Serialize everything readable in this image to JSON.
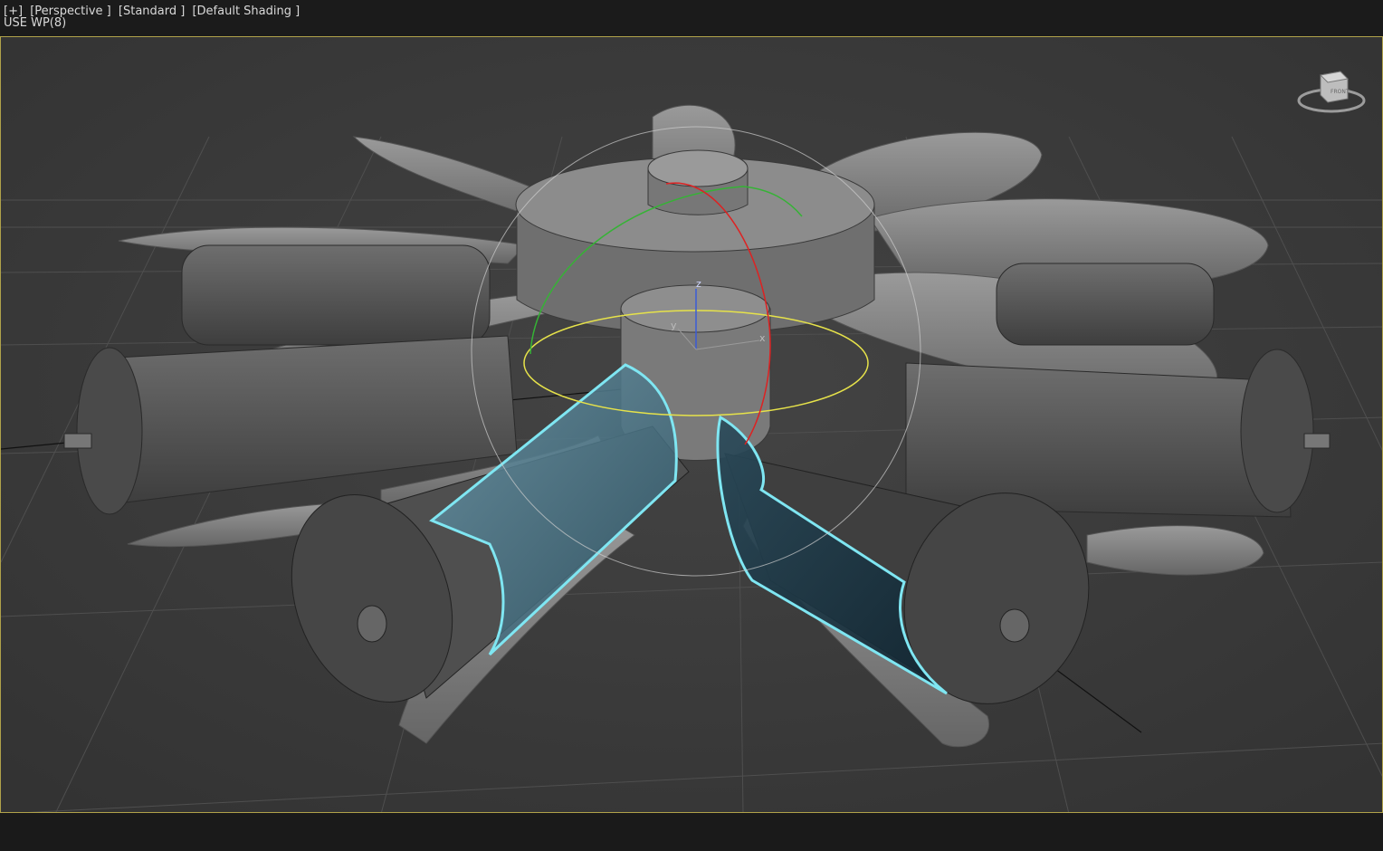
{
  "viewport": {
    "labels": [
      "[+]",
      "[Perspective ]",
      "[Standard ]",
      "[Default Shading ]"
    ],
    "workplane": "USE WP(8)"
  },
  "gizmo": {
    "z": "z",
    "y": "y",
    "x": "x"
  },
  "tripod": {
    "z": "z",
    "x": "x"
  },
  "viewcube": {
    "face": "FRONT"
  },
  "colors": {
    "selection": "#7fe6f2",
    "frame": "#b0a24a",
    "background": "#3b3b3b"
  }
}
